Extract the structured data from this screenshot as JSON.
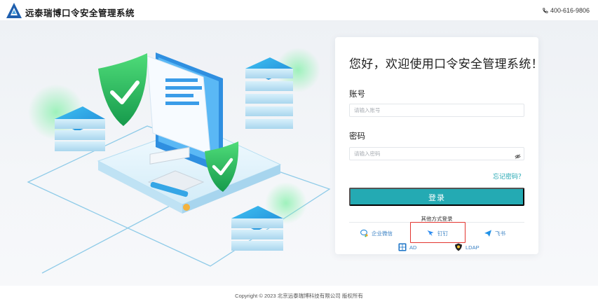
{
  "header": {
    "brand": "远泰瑞博口令安全管理系统",
    "hotline": "400-616-9806"
  },
  "login": {
    "welcome": "您好，欢迎使用口令安全管理系统！",
    "account_label": "账号",
    "account_placeholder": "请输入账号",
    "password_label": "密码",
    "password_placeholder": "请输入密码",
    "forgot": "忘记密码？",
    "submit": "登录",
    "other_methods": "其他方式登录",
    "methods": [
      {
        "label": "企业微信",
        "icon": "wecom-icon"
      },
      {
        "label": "钉钉",
        "icon": "dingtalk-icon"
      },
      {
        "label": "飞书",
        "icon": "feishu-icon"
      },
      {
        "label": "AD",
        "icon": "windows-ad-icon"
      },
      {
        "label": "LDAP",
        "icon": "ldap-icon"
      }
    ]
  },
  "footer": {
    "copyright": "Copyright © 2023 北京远泰瑞博科技有限公司 版权所有"
  },
  "colors": {
    "accent": "#24aab3",
    "link": "#1fa5b1",
    "highlight": "#e3342f"
  }
}
